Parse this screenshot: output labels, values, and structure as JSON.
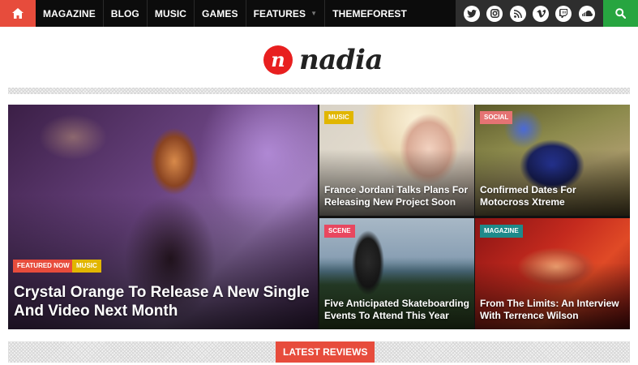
{
  "nav": {
    "items": [
      "MAGAZINE",
      "BLOG",
      "MUSIC",
      "GAMES",
      "FEATURES",
      "THEMEFOREST"
    ],
    "social_icons": [
      "twitter-icon",
      "instagram-icon",
      "rss-icon",
      "vimeo-icon",
      "twitch-icon",
      "soundcloud-icon"
    ]
  },
  "logo": {
    "mark": "n",
    "text": "nadia"
  },
  "featured": {
    "badges": [
      "FEATURED NOW",
      "MUSIC"
    ],
    "title": "Crystal Orange To Release A New Single And Video Next Month"
  },
  "posts": [
    {
      "category": "MUSIC",
      "title": "France Jordani Talks Plans For Releasing New Project Soon",
      "color": "#e1b600"
    },
    {
      "category": "SOCIAL",
      "title": "Confirmed Dates For Motocross Xtreme",
      "color": "#e57373"
    },
    {
      "category": "SCENE",
      "title": "Five Anticipated Skateboarding Events To Attend This Year",
      "color": "#e8475f"
    },
    {
      "category": "MAGAZINE",
      "title": "From The Limits: An Interview With Terrence Wilson",
      "color": "#1e8a8a"
    }
  ],
  "sections": {
    "latest_reviews": "LATEST REVIEWS"
  },
  "colors": {
    "accent": "#e74c3c",
    "search": "#27a540",
    "nav_bg": "#0c0c0c"
  }
}
